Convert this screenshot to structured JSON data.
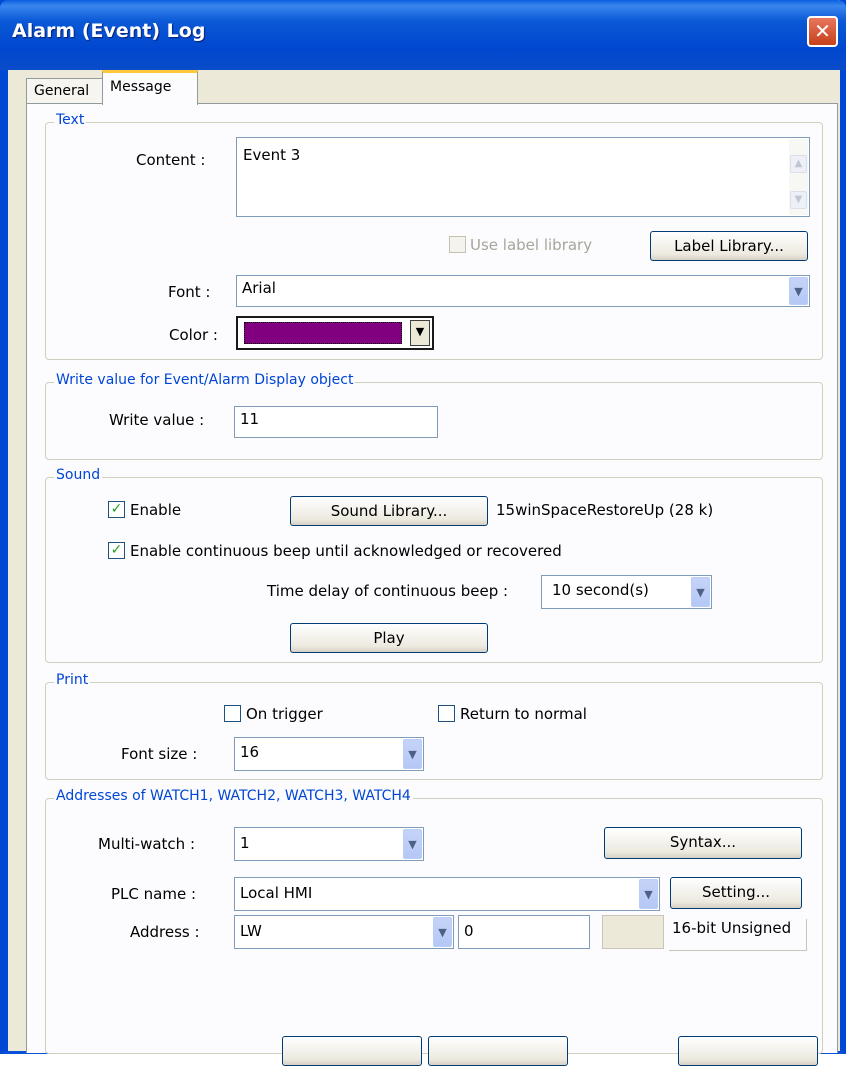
{
  "window": {
    "title": "Alarm (Event) Log",
    "close": "✕"
  },
  "tabs": [
    {
      "label": "General"
    },
    {
      "label": "Message"
    }
  ],
  "text_group": {
    "legend": "Text",
    "content_label": "Content :",
    "content_value": "Event 3",
    "use_label_library": "Use label library",
    "label_library_button": "Label Library...",
    "font_label": "Font :",
    "font_value": "Arial",
    "color_label": "Color :",
    "color_value": "#800080"
  },
  "write_group": {
    "legend": "Write value for Event/Alarm Display object",
    "write_value_label": "Write value :",
    "write_value": "11"
  },
  "sound_group": {
    "legend": "Sound",
    "enable_label": "Enable",
    "enable_checked": true,
    "sound_library_button": "Sound Library...",
    "sound_file": "15winSpaceRestoreUp (28 k)",
    "continuous_label": "Enable continuous beep until acknowledged or recovered",
    "continuous_checked": true,
    "delay_label": "Time delay of continuous beep :",
    "delay_value": "10  second(s)",
    "play_button": "Play"
  },
  "print_group": {
    "legend": "Print",
    "on_trigger_label": "On trigger",
    "return_normal_label": "Return to normal",
    "font_size_label": "Font size :",
    "font_size_value": "16"
  },
  "watch_group": {
    "legend": "Addresses of WATCH1, WATCH2, WATCH3, WATCH4",
    "multiwatch_label": "Multi-watch :",
    "multiwatch_value": "1",
    "syntax_button": "Syntax...",
    "plc_label": "PLC name :",
    "plc_value": "Local HMI",
    "setting_button": "Setting...",
    "address_label": "Address :",
    "address_type": "LW",
    "address_value": "0",
    "data_type": "16-bit Unsigned"
  },
  "check_mark": "✓",
  "arrow_down": "▼",
  "arrow_up": "▲"
}
